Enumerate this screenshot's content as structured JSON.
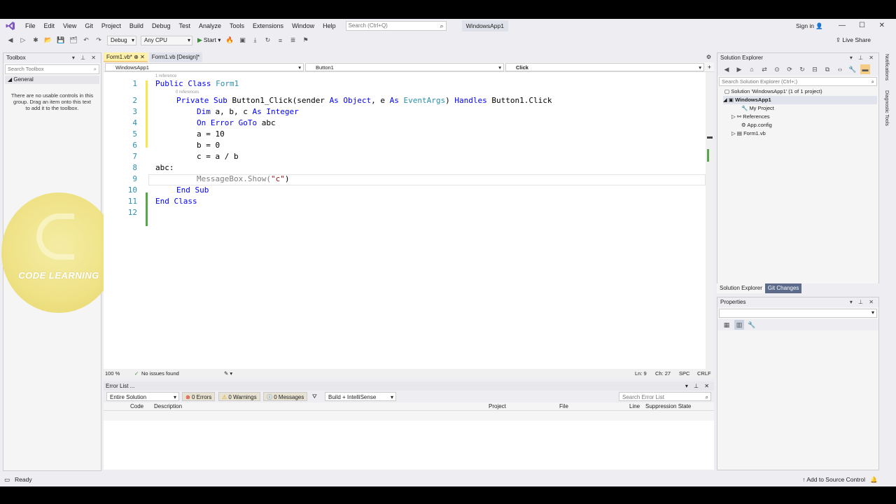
{
  "menu": {
    "items": [
      "File",
      "Edit",
      "View",
      "Git",
      "Project",
      "Build",
      "Debug",
      "Test",
      "Analyze",
      "Tools",
      "Extensions",
      "Window",
      "Help"
    ],
    "search_placeholder": "Search (Ctrl+Q)",
    "solution_name": "WindowsApp1",
    "sign_in": "Sign in"
  },
  "toolbar": {
    "config": "Debug",
    "platform": "Any CPU",
    "start": "Start",
    "live_share": "Live Share"
  },
  "toolbox": {
    "title": "Toolbox",
    "search_placeholder": "Search Toolbox",
    "group": "General",
    "empty_message": "There are no usable controls in this group. Drag an item onto this text to add it to the toolbox."
  },
  "editor": {
    "tabs": [
      "Form1.vb*",
      "Form1.vb [Design]*"
    ],
    "nav": {
      "project": "WindowsApp1",
      "object": "Button1",
      "event": "Click"
    },
    "codelens": [
      "1 reference",
      "0 references"
    ],
    "line_numbers": [
      "1",
      "2",
      "3",
      "4",
      "5",
      "6",
      "7",
      "8",
      "9",
      "10",
      "11",
      "12"
    ],
    "lines": [
      {
        "kw1": "Public Class",
        "rest": " Form1"
      },
      {
        "kw1": "Private Sub",
        "rest": " Button1_Click(sender ",
        "kw2": "As Object",
        "rest2": ", e ",
        "kw3": "As",
        "ty": " EventArgs",
        "rest3": ") ",
        "kw4": "Handles",
        "rest4": " Button1.Click"
      },
      {
        "kw1": "Dim",
        "rest": " a, b, c ",
        "kw2": "As Integer"
      },
      {
        "kw1": "On Error GoTo",
        "rest": " abc"
      },
      {
        "rest": "a = 10"
      },
      {
        "rest": "b = 0"
      },
      {
        "rest": "c = a / b"
      },
      {
        "rest": "abc:"
      },
      {
        "rest": "MessageBox.Show(",
        "str": "\"c\"",
        "rest2": ")"
      },
      {
        "kw1": "End Sub"
      },
      {
        "kw1": "End Class"
      },
      {
        "rest": ""
      }
    ],
    "zoom": "100 %",
    "issues": "No issues found",
    "ln": "Ln: 9",
    "ch": "Ch: 27",
    "spc": "SPC",
    "crlf": "CRLF"
  },
  "error_list": {
    "title": "Error List ...",
    "scope": "Entire Solution",
    "errors": "0 Errors",
    "warnings": "0 Warnings",
    "messages": "0 Messages",
    "filter": "Build + IntelliSense",
    "search_placeholder": "Search Error List",
    "columns": [
      "Code",
      "Description",
      "Project",
      "File",
      "Line",
      "Suppression State"
    ]
  },
  "solution_explorer": {
    "title": "Solution Explorer",
    "search_placeholder": "Search Solution Explorer (Ctrl+;)",
    "tree": [
      {
        "label": "Solution 'WindowsApp1' (1 of 1 project)"
      },
      {
        "label": "WindowsApp1"
      },
      {
        "label": "My Project"
      },
      {
        "label": "References"
      },
      {
        "label": "App.config"
      },
      {
        "label": "Form1.vb"
      }
    ],
    "tabs": [
      "Solution Explorer",
      "Git Changes"
    ]
  },
  "properties": {
    "title": "Properties"
  },
  "side_strip": [
    "Notifications",
    "Diagnostic Tools"
  ],
  "status": {
    "left": "Ready",
    "source_control": "Add to Source Control"
  },
  "watermark": {
    "text": "CODE LEARNING"
  },
  "colors": {
    "accent_tab": "#fff1a8",
    "keyword": "#0000ff",
    "type": "#2b91af",
    "string": "#a31515"
  }
}
